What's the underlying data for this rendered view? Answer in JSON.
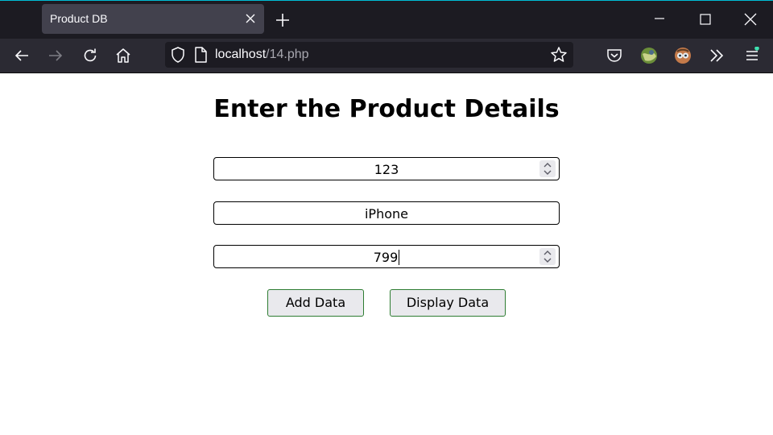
{
  "browser": {
    "tab_title": "Product DB",
    "url_host": "localhost",
    "url_path": "/14.php"
  },
  "page": {
    "heading": "Enter the Product Details",
    "fields": [
      {
        "value": "123",
        "type": "number"
      },
      {
        "value": "iPhone",
        "type": "text"
      },
      {
        "value": "799",
        "type": "number"
      }
    ],
    "buttons": {
      "add": "Add Data",
      "display": "Display Data"
    }
  },
  "colors": {
    "titlebar": "#1c1b22",
    "toolbar": "#2b2a33",
    "active_tab": "#42414d",
    "button_border": "#2e7d32",
    "button_bg": "#e9e9ed"
  }
}
